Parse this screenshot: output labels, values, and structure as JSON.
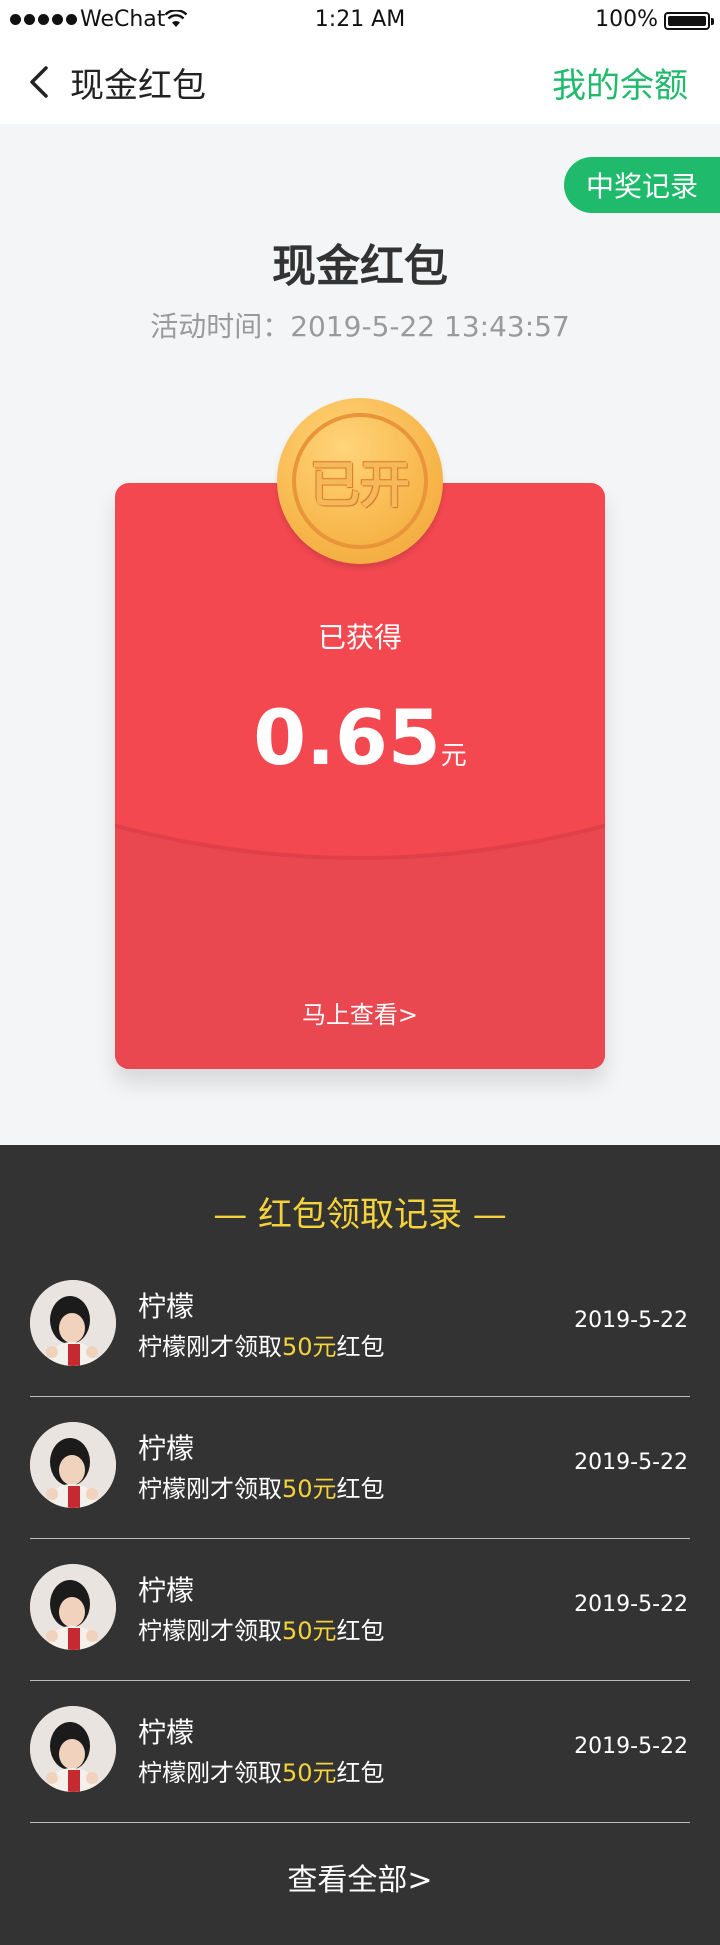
{
  "status_bar": {
    "carrier": "WeChat",
    "time": "1:21 AM",
    "battery": "100%"
  },
  "nav": {
    "back_icon": "chevron-left-icon",
    "title": "现金红包",
    "right_link": "我的余额"
  },
  "main": {
    "record_button": "中奖记录",
    "title": "现金红包",
    "activity_time": "活动时间：2019-5-22 13:43:57",
    "coin_label": "已开",
    "obtained_label": "已获得",
    "amount": "0.65",
    "amount_unit": "元",
    "view_now": "马上查看>"
  },
  "records": {
    "heading": "— 红包领取记录 —",
    "items": [
      {
        "name": "柠檬",
        "desc_pre": "柠檬刚才领取",
        "desc_amount": "50元",
        "desc_post": "红包",
        "date": "2019-5-22"
      },
      {
        "name": "柠檬",
        "desc_pre": "柠檬刚才领取",
        "desc_amount": "50元",
        "desc_post": "红包",
        "date": "2019-5-22"
      },
      {
        "name": "柠檬",
        "desc_pre": "柠檬刚才领取",
        "desc_amount": "50元",
        "desc_post": "红包",
        "date": "2019-5-22"
      },
      {
        "name": "柠檬",
        "desc_pre": "柠檬刚才领取",
        "desc_amount": "50元",
        "desc_post": "红包",
        "date": "2019-5-22"
      }
    ],
    "view_all": "查看全部>"
  },
  "colors": {
    "accent_green": "#1fba6b",
    "envelope_red": "#f34850",
    "highlight_yellow": "#f5d33a",
    "dark_bg": "#333333"
  }
}
